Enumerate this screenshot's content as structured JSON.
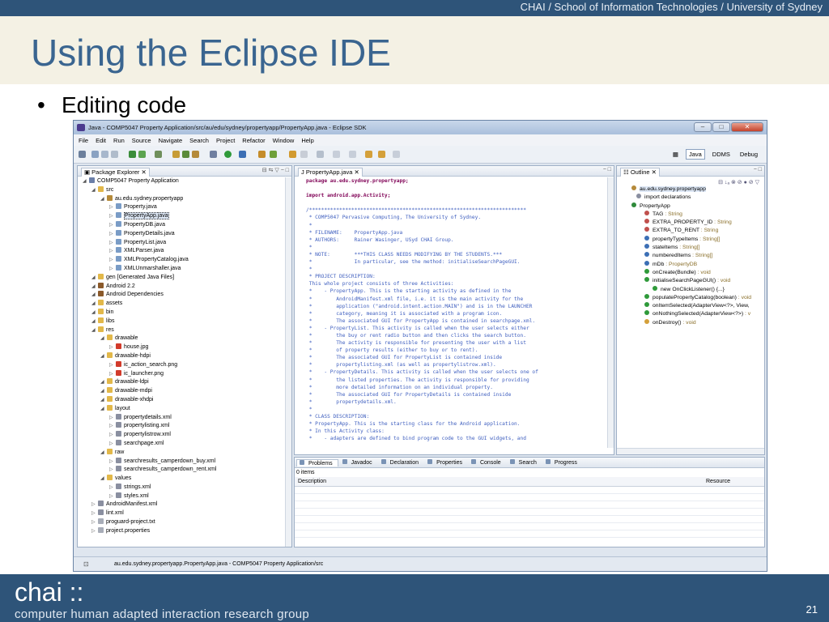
{
  "slide": {
    "crumb": "CHAI / School of Information Technologies / University of Sydney",
    "title": "Using the Eclipse IDE",
    "bullet": "Editing code",
    "logo": "chai ::",
    "tagline": "computer human adapted interaction research group",
    "page_number": "21"
  },
  "window": {
    "title": "Java - COMP5047 Property Application/src/au/edu/sydney/propertyapp/PropertyApp.java - Eclipse SDK",
    "menu": [
      "File",
      "Edit",
      "Run",
      "Source",
      "Navigate",
      "Search",
      "Project",
      "Refactor",
      "Window",
      "Help"
    ],
    "perspectives": [
      "Java",
      "DDMS",
      "Debug"
    ]
  },
  "package_explorer": {
    "tab": "Package Explorer",
    "items": [
      {
        "label": "COMP5047 Property Application",
        "depth": 0,
        "icon": "project-icon"
      },
      {
        "label": "src",
        "depth": 1,
        "icon": "folder-icon"
      },
      {
        "label": "au.edu.sydney.propertyapp",
        "depth": 2,
        "icon": "package-icon"
      },
      {
        "label": "Property.java",
        "depth": 3,
        "icon": "java-file-icon"
      },
      {
        "label": "PropertyApp.java",
        "depth": 3,
        "icon": "java-file-icon",
        "selected": true
      },
      {
        "label": "PropertyDB.java",
        "depth": 3,
        "icon": "java-file-icon"
      },
      {
        "label": "PropertyDetails.java",
        "depth": 3,
        "icon": "java-file-icon"
      },
      {
        "label": "PropertyList.java",
        "depth": 3,
        "icon": "java-file-icon"
      },
      {
        "label": "XMLParser.java",
        "depth": 3,
        "icon": "java-file-icon"
      },
      {
        "label": "XMLPropertyCatalog.java",
        "depth": 3,
        "icon": "java-file-icon"
      },
      {
        "label": "XMLUnmarshaller.java",
        "depth": 3,
        "icon": "java-file-icon"
      },
      {
        "label": "gen [Generated Java Files]",
        "depth": 1,
        "icon": "folder-icon"
      },
      {
        "label": "Android 2.2",
        "depth": 1,
        "icon": "library-icon"
      },
      {
        "label": "Android Dependencies",
        "depth": 1,
        "icon": "library-icon"
      },
      {
        "label": "assets",
        "depth": 1,
        "icon": "folder-icon"
      },
      {
        "label": "bin",
        "depth": 1,
        "icon": "folder-icon"
      },
      {
        "label": "libs",
        "depth": 1,
        "icon": "folder-icon"
      },
      {
        "label": "res",
        "depth": 1,
        "icon": "folder-icon"
      },
      {
        "label": "drawable",
        "depth": 2,
        "icon": "folder-icon"
      },
      {
        "label": "house.jpg",
        "depth": 3,
        "icon": "image-icon"
      },
      {
        "label": "drawable-hdpi",
        "depth": 2,
        "icon": "folder-icon"
      },
      {
        "label": "ic_action_search.png",
        "depth": 3,
        "icon": "image-icon"
      },
      {
        "label": "ic_launcher.png",
        "depth": 3,
        "icon": "image-icon"
      },
      {
        "label": "drawable-ldpi",
        "depth": 2,
        "icon": "folder-icon"
      },
      {
        "label": "drawable-mdpi",
        "depth": 2,
        "icon": "folder-icon"
      },
      {
        "label": "drawable-xhdpi",
        "depth": 2,
        "icon": "folder-icon"
      },
      {
        "label": "layout",
        "depth": 2,
        "icon": "folder-icon"
      },
      {
        "label": "propertydetails.xml",
        "depth": 3,
        "icon": "xml-file-icon"
      },
      {
        "label": "propertylisting.xml",
        "depth": 3,
        "icon": "xml-file-icon"
      },
      {
        "label": "propertylistrow.xml",
        "depth": 3,
        "icon": "xml-file-icon"
      },
      {
        "label": "searchpage.xml",
        "depth": 3,
        "icon": "xml-file-icon"
      },
      {
        "label": "raw",
        "depth": 2,
        "icon": "folder-icon"
      },
      {
        "label": "searchresults_camperdown_buy.xml",
        "depth": 3,
        "icon": "xml-file-icon"
      },
      {
        "label": "searchresults_camperdown_rent.xml",
        "depth": 3,
        "icon": "xml-file-icon"
      },
      {
        "label": "values",
        "depth": 2,
        "icon": "folder-icon"
      },
      {
        "label": "strings.xml",
        "depth": 3,
        "icon": "xml-file-icon"
      },
      {
        "label": "styles.xml",
        "depth": 3,
        "icon": "xml-file-icon"
      },
      {
        "label": "AndroidManifest.xml",
        "depth": 1,
        "icon": "xml-file-icon"
      },
      {
        "label": "lint.xml",
        "depth": 1,
        "icon": "xml-file-icon"
      },
      {
        "label": "proguard-project.txt",
        "depth": 1,
        "icon": "text-file-icon"
      },
      {
        "label": "project.properties",
        "depth": 1,
        "icon": "text-file-icon"
      }
    ]
  },
  "editor": {
    "tab": "PropertyApp.java",
    "lines": [
      {
        "t": "package au.edu.sydney.propertyapp;",
        "c": "kw"
      },
      {
        "t": "",
        "c": ""
      },
      {
        "t": "import android.app.Activity;",
        "c": "kw"
      },
      {
        "t": "",
        "c": ""
      },
      {
        "t": "/************************************************************************",
        "c": "cm"
      },
      {
        "t": " * COMP5047 Pervasive Computing, The University of Sydney.",
        "c": "cm"
      },
      {
        "t": " *",
        "c": "cm"
      },
      {
        "t": " * FILENAME:    PropertyApp.java",
        "c": "cm"
      },
      {
        "t": " * AUTHORS:     Rainer Wasinger, USyd CHAI Group.",
        "c": "cm"
      },
      {
        "t": " *",
        "c": "cm"
      },
      {
        "t": " * NOTE:        ***THIS CLASS NEEDS MODIFYING BY THE STUDENTS.***",
        "c": "cm"
      },
      {
        "t": " *              In particular, see the method: initialiseSearchPageGUI.",
        "c": "cm"
      },
      {
        "t": " *",
        "c": "cm"
      },
      {
        "t": " * PROJECT DESCRIPTION:",
        "c": "cm"
      },
      {
        "t": " This whole project consists of three Activities:",
        "c": "cm"
      },
      {
        "t": " *    - PropertyApp. This is the starting activity as defined in the",
        "c": "cm"
      },
      {
        "t": " *        AndroidManifest.xml file, i.e. it is the main activity for the",
        "c": "cm"
      },
      {
        "t": " *        application (\"android.intent.action.MAIN\") and is in the LAUNCHER",
        "c": "cm"
      },
      {
        "t": " *        category, meaning it is associated with a program icon.",
        "c": "cm"
      },
      {
        "t": " *        The associated GUI for PropertyApp is contained in searchpage.xml.",
        "c": "cm"
      },
      {
        "t": " *    - PropertyList. This activity is called when the user selects either",
        "c": "cm"
      },
      {
        "t": " *        the buy or rent radio button and then clicks the search button.",
        "c": "cm"
      },
      {
        "t": " *        The activity is responsible for presenting the user with a list",
        "c": "cm"
      },
      {
        "t": " *        of property results (either to buy or to rent).",
        "c": "cm"
      },
      {
        "t": " *        The associated GUI for PropertyList is contained inside",
        "c": "cm"
      },
      {
        "t": " *        propertylisting.xml (as well as propertylistrow.xml).",
        "c": "cm"
      },
      {
        "t": " *    - PropertyDetails. This activity is called when the user selects one of",
        "c": "cm"
      },
      {
        "t": " *        the listed properties. The activity is responsible for providing",
        "c": "cm"
      },
      {
        "t": " *        more detailed information on an individual property.",
        "c": "cm"
      },
      {
        "t": " *        The associated GUI for PropertyDetails is contained inside",
        "c": "cm"
      },
      {
        "t": " *        propertydetails.xml.",
        "c": "cm"
      },
      {
        "t": " *",
        "c": "cm"
      },
      {
        "t": " * CLASS DESCRIPTION:",
        "c": "cm"
      },
      {
        "t": " * PropertyApp. This is the starting class for the Android application.",
        "c": "cm"
      },
      {
        "t": " * In this Activity class:",
        "c": "cm"
      },
      {
        "t": " *    - adapters are defined to bind program code to the GUI widgets, and",
        "c": "cm"
      }
    ]
  },
  "outline": {
    "tab": "Outline",
    "items": [
      {
        "label": "au.edu.sydney.propertyapp",
        "type": ""
      },
      {
        "label": "import declarations",
        "type": ""
      },
      {
        "label": "PropertyApp",
        "type": ""
      },
      {
        "label": "TAG",
        "type": " : String"
      },
      {
        "label": "EXTRA_PROPERTY_ID",
        "type": " : String"
      },
      {
        "label": "EXTRA_TO_RENT",
        "type": " : String"
      },
      {
        "label": "propertyTypeItems",
        "type": " : String[]"
      },
      {
        "label": "stateItems",
        "type": " : String[]"
      },
      {
        "label": "numberedItems",
        "type": " : String[]"
      },
      {
        "label": "mDb",
        "type": " : PropertyDB"
      },
      {
        "label": "onCreate(Bundle)",
        "type": " : void"
      },
      {
        "label": "initialiseSearchPageGUI()",
        "type": " : void"
      },
      {
        "label": "new OnClickListener() {...}",
        "type": ""
      },
      {
        "label": "populatePropertyCatalog(boolean)",
        "type": " : void"
      },
      {
        "label": "onItemSelected(AdapterView<?>, View,",
        "type": ""
      },
      {
        "label": "onNothingSelected(AdapterView<?>)",
        "type": " : v"
      },
      {
        "label": "onDestroy()",
        "type": " : void"
      }
    ]
  },
  "problems": {
    "tabs": [
      "Problems",
      "Javadoc",
      "Declaration",
      "Properties",
      "Console",
      "Search",
      "Progress"
    ],
    "count": "0 items",
    "columns": [
      "Description",
      "Resource"
    ]
  },
  "status_bar": {
    "text": "au.edu.sydney.propertyapp.PropertyApp.java - COMP5047 Property Application/src"
  }
}
